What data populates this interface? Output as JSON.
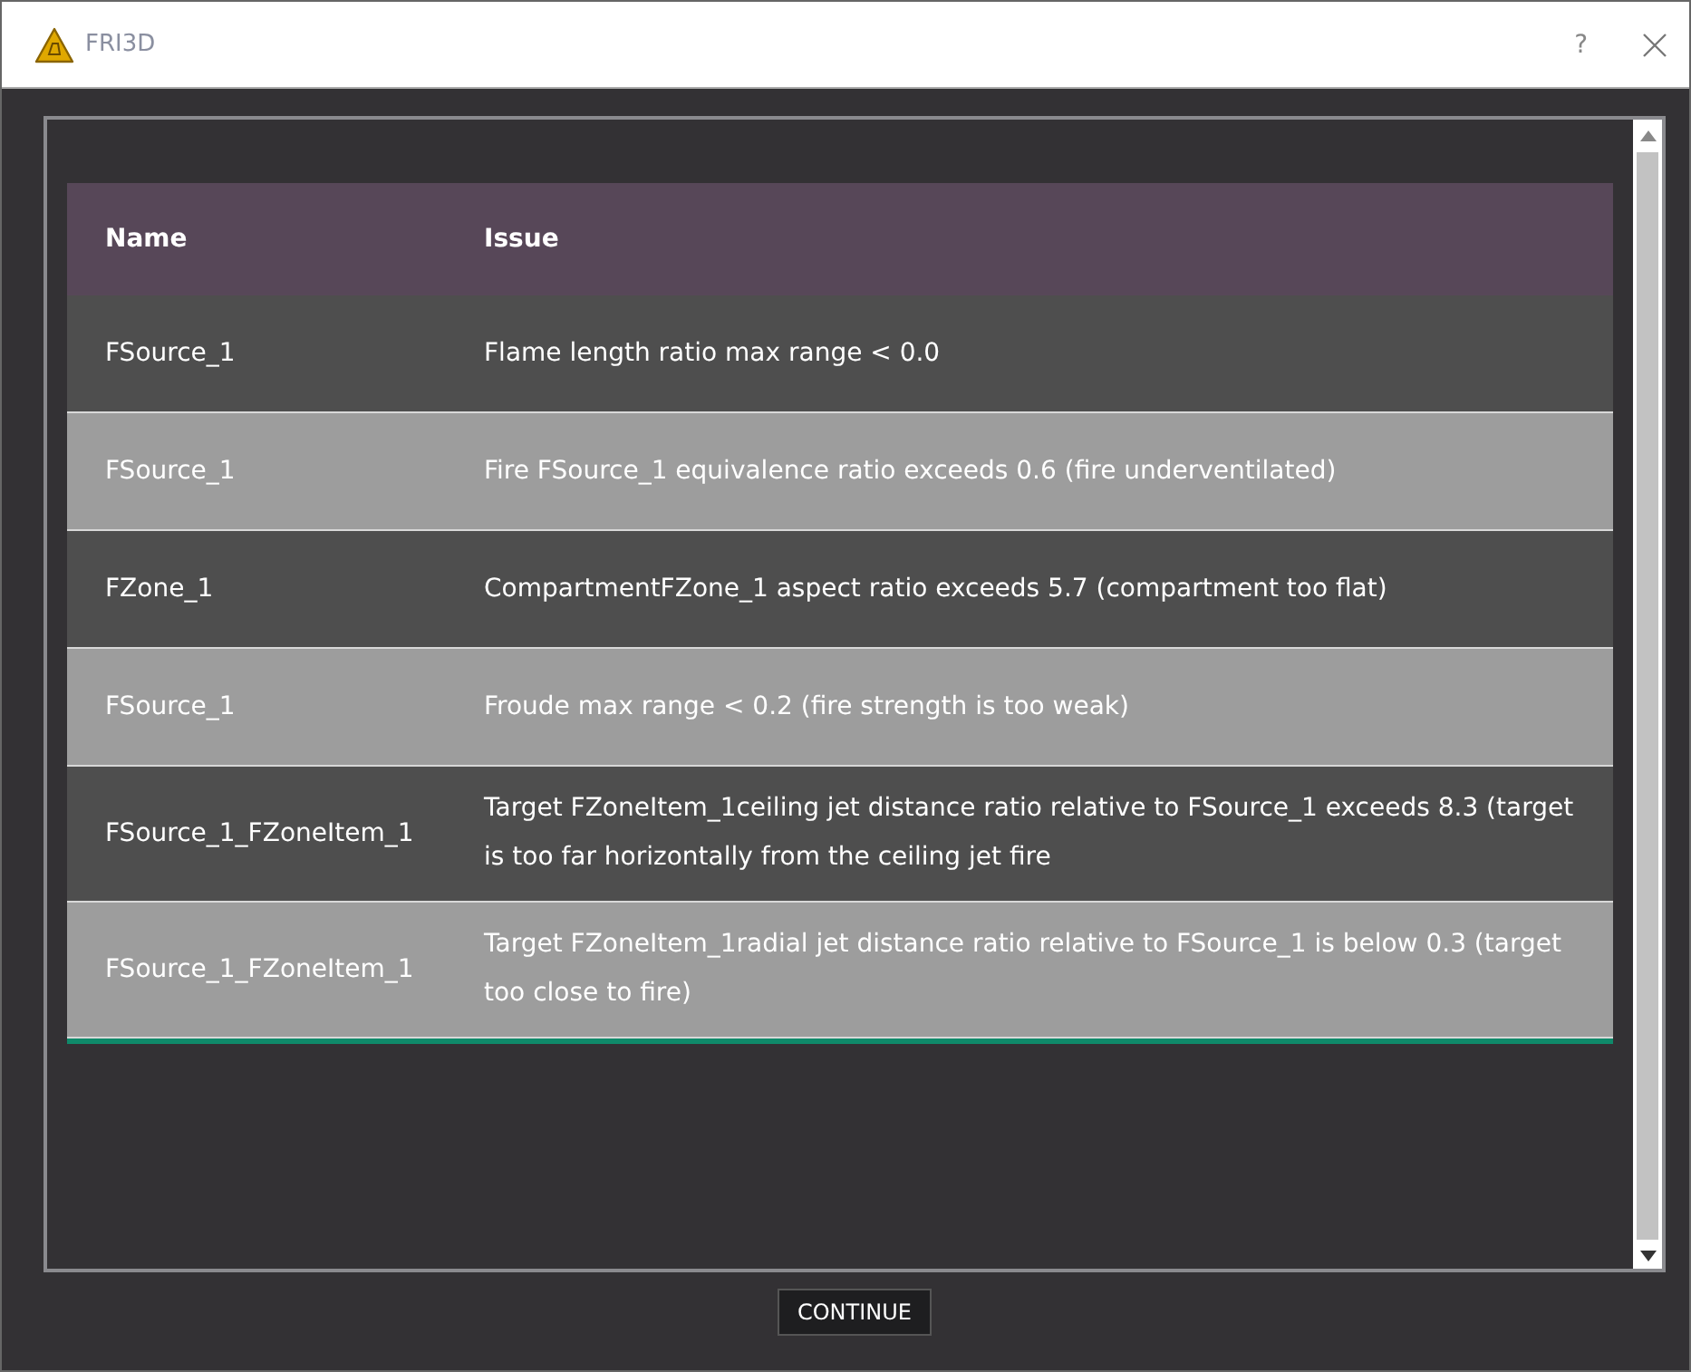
{
  "window": {
    "title": "FRI3D",
    "help": "?"
  },
  "table": {
    "columns": [
      "Name",
      "Issue"
    ],
    "rows": [
      {
        "name": "FSource_1",
        "issue": "Flame length ratio max range < 0.0"
      },
      {
        "name": "FSource_1",
        "issue": "Fire FSource_1 equivalence ratio exceeds 0.6 (fire underventilated)"
      },
      {
        "name": "FZone_1",
        "issue": "CompartmentFZone_1 aspect ratio exceeds 5.7 (compartment too flat)"
      },
      {
        "name": "FSource_1",
        "issue": "Froude max range < 0.2 (fire strength is too weak)"
      },
      {
        "name": "FSource_1_FZoneItem_1",
        "issue": "Target FZoneItem_1ceiling jet distance ratio relative to FSource_1 exceeds 8.3 (target is too far horizontally from the ceiling jet fire"
      },
      {
        "name": "FSource_1_FZoneItem_1",
        "issue": "Target FZoneItem_1radial jet distance ratio relative to FSource_1 is below 0.3 (target too close to fire)"
      }
    ]
  },
  "buttons": [
    "CONTINUE"
  ]
}
